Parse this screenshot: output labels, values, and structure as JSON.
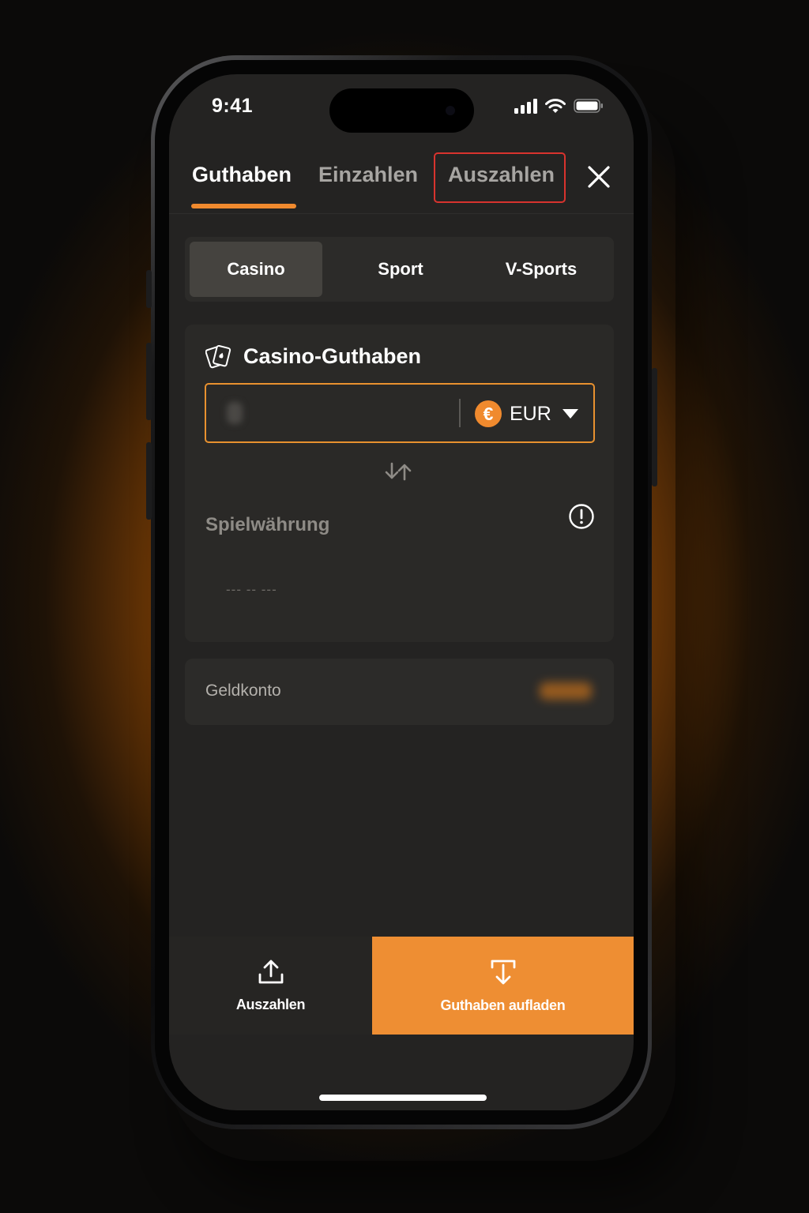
{
  "status_bar": {
    "time": "9:41"
  },
  "tabs": [
    {
      "label": "Guthaben",
      "active": true
    },
    {
      "label": "Einzahlen",
      "active": false
    },
    {
      "label": "Auszahlen",
      "active": false,
      "highlighted": true
    }
  ],
  "segments": [
    {
      "label": "Casino",
      "active": true
    },
    {
      "label": "Sport",
      "active": false
    },
    {
      "label": "V-Sports",
      "active": false
    }
  ],
  "balance_card": {
    "title": "Casino-Guthaben",
    "icon": "cards-icon",
    "currency": {
      "symbol": "€",
      "code": "EUR"
    },
    "game_currency_label": "Spielwährung",
    "game_currency_value": "--- -- ---"
  },
  "account_row": {
    "label": "Geldkonto"
  },
  "bottom_actions": {
    "withdraw_label": "Auszahlen",
    "topup_label": "Guthaben aufladen"
  },
  "colors": {
    "accent": "#ee8e33",
    "highlight_outline": "#d8332e",
    "screen_bg": "#242322",
    "card_bg": "#2a2927"
  }
}
